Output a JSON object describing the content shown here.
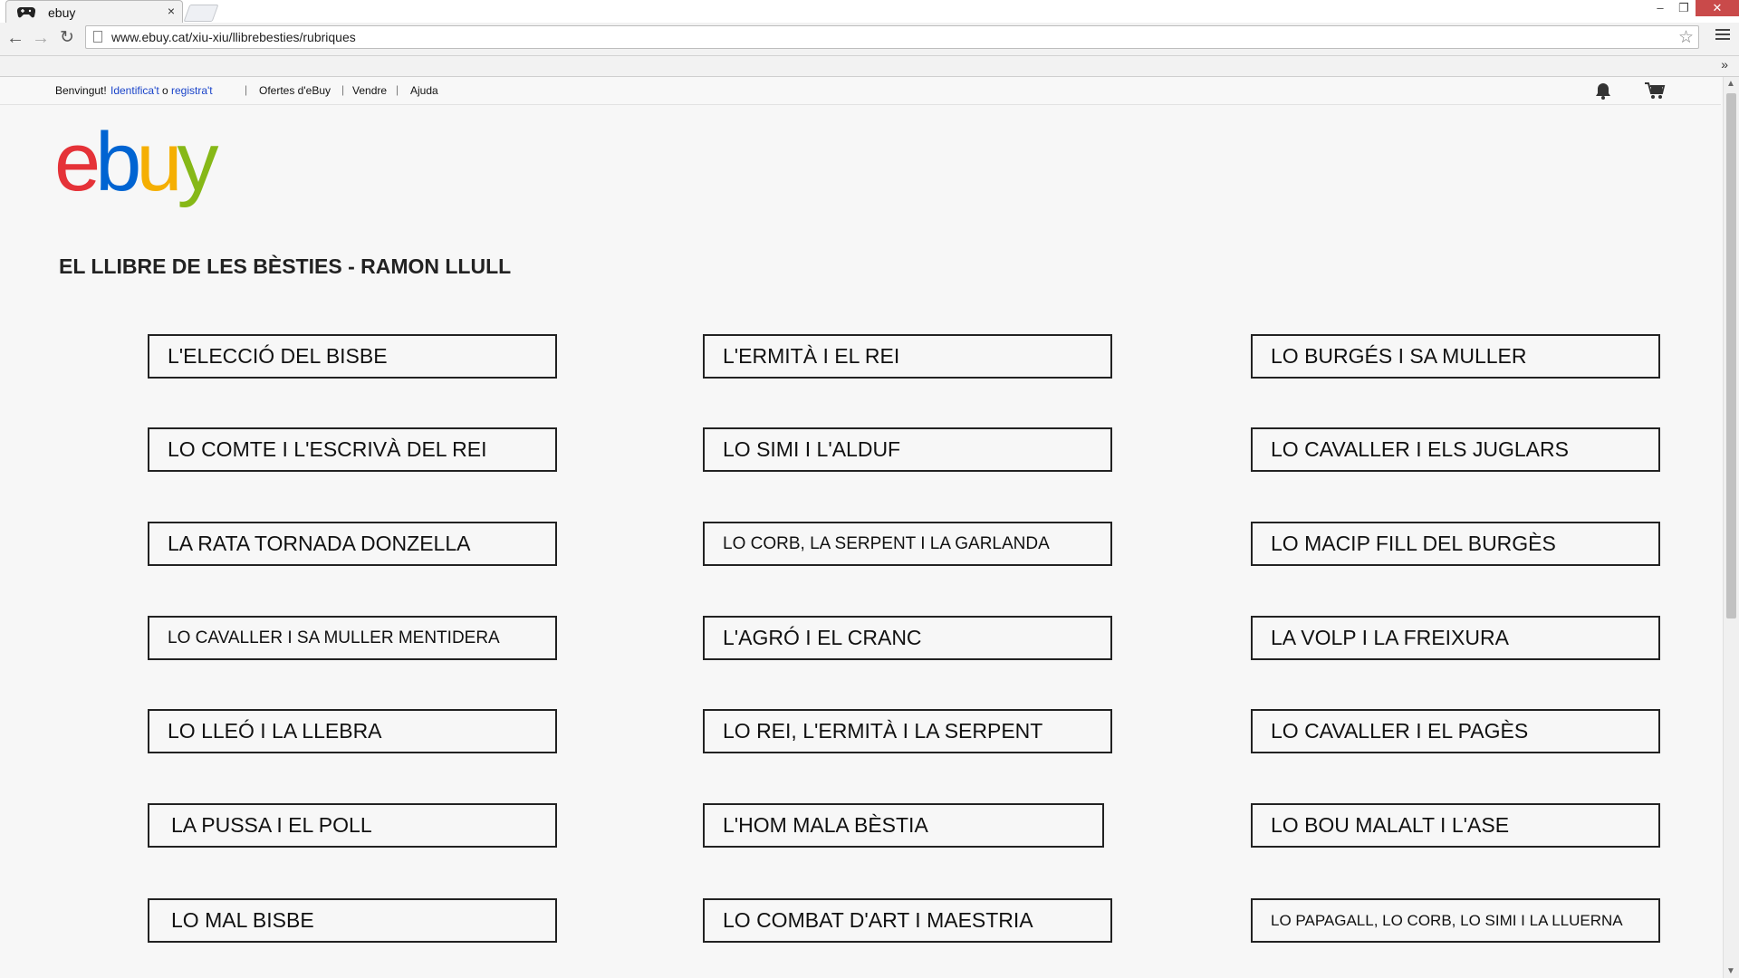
{
  "browser": {
    "tab_title": "ebuy",
    "tab_close": "×",
    "url": "www.ebuy.cat/xiu-xiu/llibrebesties/rubriques",
    "bookmarks_chevron": "»",
    "window_controls": {
      "minimize": "–",
      "restore": "❐",
      "close": "✕"
    }
  },
  "topbar": {
    "greeting": "Benvingut!",
    "signin": "Identifica't",
    "or": "o",
    "register": "registra't",
    "links": [
      "Ofertes d'eBuy",
      "Vendre",
      "Ajuda"
    ],
    "separator": "|"
  },
  "logo": {
    "letters": [
      "e",
      "b",
      "u",
      "y"
    ],
    "colors": [
      "#e53238",
      "#0064d2",
      "#f5af02",
      "#86b817"
    ]
  },
  "page": {
    "title": "EL LLIBRE DE LES BÈSTIES - RAMON LLULL"
  },
  "rubriques": {
    "col1": [
      "L'ELECCIÓ DEL BISBE",
      "LO COMTE I L'ESCRIVÀ DEL REI",
      "LA RATA TORNADA DONZELLA",
      "LO CAVALLER I SA MULLER MENTIDERA",
      "LO LLEÓ I LA LLEBRA",
      "LA PUSSA I EL POLL",
      "LO MAL BISBE"
    ],
    "col2": [
      "L'ERMITÀ I EL REI",
      "LO SIMI I L'ALDUF",
      "LO CORB, LA SERPENT I LA GARLANDA",
      "L'AGRÓ I EL CRANC",
      "LO REI, L'ERMITÀ I LA SERPENT",
      "L'HOM MALA BÈSTIA",
      "LO COMBAT D'ART I MAESTRIA"
    ],
    "col3": [
      "LO BURGÉS I SA MULLER",
      "LO CAVALLER I ELS JUGLARS",
      "LO MACIP FILL DEL BURGÈS",
      "LA VOLP I LA FREIXURA",
      "LO CAVALLER I EL PAGÈS",
      "LO BOU MALALT I L'ASE",
      "LO PAPAGALL, LO CORB, LO SIMI I LA LLUERNA"
    ]
  }
}
